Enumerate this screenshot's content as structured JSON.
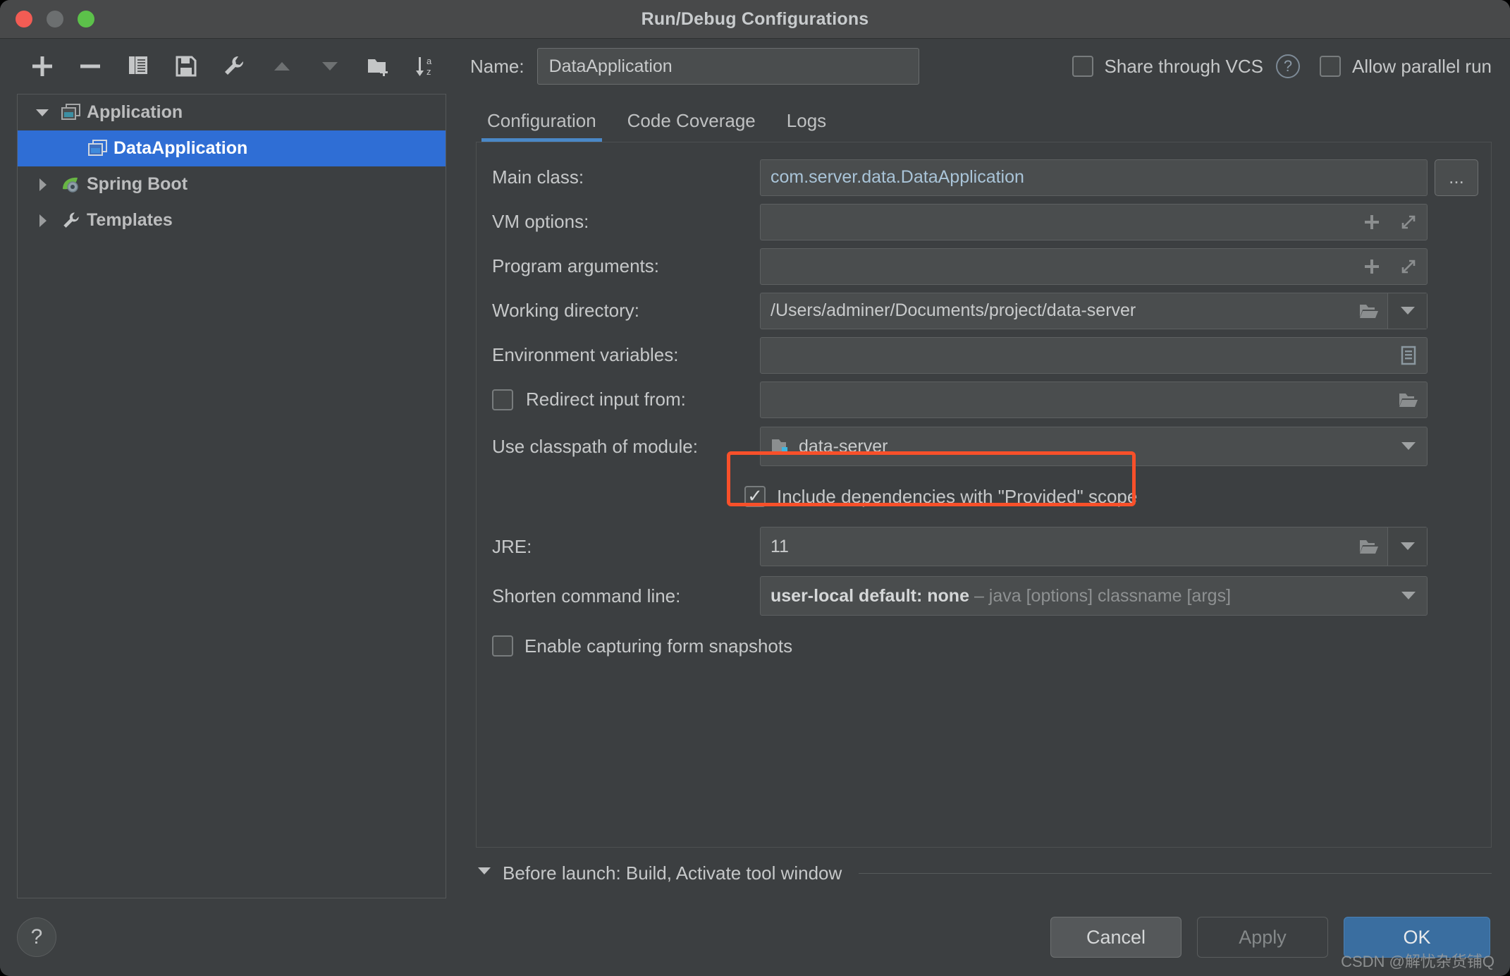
{
  "window": {
    "title": "Run/Debug Configurations",
    "traffic_lights": [
      "close",
      "minimize",
      "zoom"
    ],
    "accent_blue": "#2f6ed5",
    "tab_underline": "#4a88c7",
    "highlight_red": "#f8502a"
  },
  "toolbar": {
    "buttons": [
      {
        "name": "add",
        "icon": "plus-icon",
        "tooltip": "Add New Configuration"
      },
      {
        "name": "remove",
        "icon": "minus-icon",
        "tooltip": "Remove Configuration"
      },
      {
        "name": "copy",
        "icon": "copy-icon",
        "tooltip": "Copy Configuration"
      },
      {
        "name": "save",
        "icon": "save-icon",
        "tooltip": "Save Configuration"
      },
      {
        "name": "edit-templates",
        "icon": "wrench-icon",
        "tooltip": "Edit Templates"
      },
      {
        "name": "move-up",
        "icon": "triangle-up-icon",
        "tooltip": "Move Up"
      },
      {
        "name": "move-down",
        "icon": "triangle-down-icon",
        "tooltip": "Move Down"
      },
      {
        "name": "new-folder",
        "icon": "folder-add-icon",
        "tooltip": "Create New Folder"
      },
      {
        "name": "sort",
        "icon": "sort-az-icon",
        "tooltip": "Sort Configurations"
      }
    ]
  },
  "tree": {
    "items": [
      {
        "label": "Application",
        "icon": "application-icon",
        "twisty": "expanded",
        "level": 0,
        "selected": false
      },
      {
        "label": "DataApplication",
        "icon": "application-run-icon",
        "twisty": "none",
        "level": 1,
        "selected": true
      },
      {
        "label": "Spring Boot",
        "icon": "spring-boot-icon",
        "twisty": "collapsed",
        "level": 0,
        "selected": false
      },
      {
        "label": "Templates",
        "icon": "wrench-icon",
        "twisty": "collapsed",
        "level": 0,
        "selected": false
      }
    ]
  },
  "help": {
    "label": "?"
  },
  "header": {
    "name_label": "Name:",
    "name_value": "DataApplication",
    "name_placeholder": "",
    "share_vcs_label": "Share through VCS",
    "share_vcs_checked": false,
    "share_vcs_help": "?",
    "allow_parallel_label": "Allow parallel run",
    "allow_parallel_checked": false
  },
  "tabs": [
    {
      "label": "Configuration",
      "active": true
    },
    {
      "label": "Code Coverage",
      "active": false
    },
    {
      "label": "Logs",
      "active": false
    }
  ],
  "form": {
    "main_class": {
      "label": "Main class:",
      "value": "com.server.data.DataApplication",
      "browse_label": "..."
    },
    "vm_options": {
      "label": "VM options:",
      "value": "",
      "icons": [
        "plus-icon",
        "expand-icon"
      ]
    },
    "program_arguments": {
      "label": "Program arguments:",
      "value": "",
      "icons": [
        "plus-icon",
        "expand-icon"
      ]
    },
    "working_directory": {
      "label": "Working directory:",
      "value": "/Users/adminer/Documents/project/data-server",
      "icons": [
        "folder-icon",
        "chevron-down-icon"
      ]
    },
    "environment_variables": {
      "label": "Environment variables:",
      "value": "",
      "icons": [
        "list-edit-icon"
      ]
    },
    "redirect_input": {
      "label": "Redirect input from:",
      "checked": false,
      "value": "",
      "icons": [
        "folder-icon"
      ]
    },
    "classpath_module": {
      "label": "Use classpath of module:",
      "value": "data-server",
      "icon": "module-folder-icon",
      "icons": [
        "chevron-down-icon"
      ]
    },
    "include_provided": {
      "label": "Include dependencies with \"Provided\" scope",
      "checked": true,
      "highlighted": true
    },
    "jre": {
      "label": "JRE:",
      "value": "11",
      "icons": [
        "folder-icon",
        "chevron-down-icon"
      ]
    },
    "shorten_command_line": {
      "label": "Shorten command line:",
      "value_bold": "user-local default: none",
      "value_hint": "– java [options] classname [args]",
      "icons": [
        "chevron-down-icon"
      ]
    },
    "enable_snapshots": {
      "label": "Enable capturing form snapshots",
      "checked": false
    }
  },
  "before_launch": {
    "twisty": "expanded",
    "label": "Before launch: Build, Activate tool window"
  },
  "footer": {
    "cancel_label": "Cancel",
    "apply_label": "Apply",
    "apply_disabled": true,
    "ok_label": "OK"
  },
  "watermark": {
    "text": "CSDN @解忧杂货铺Q"
  }
}
